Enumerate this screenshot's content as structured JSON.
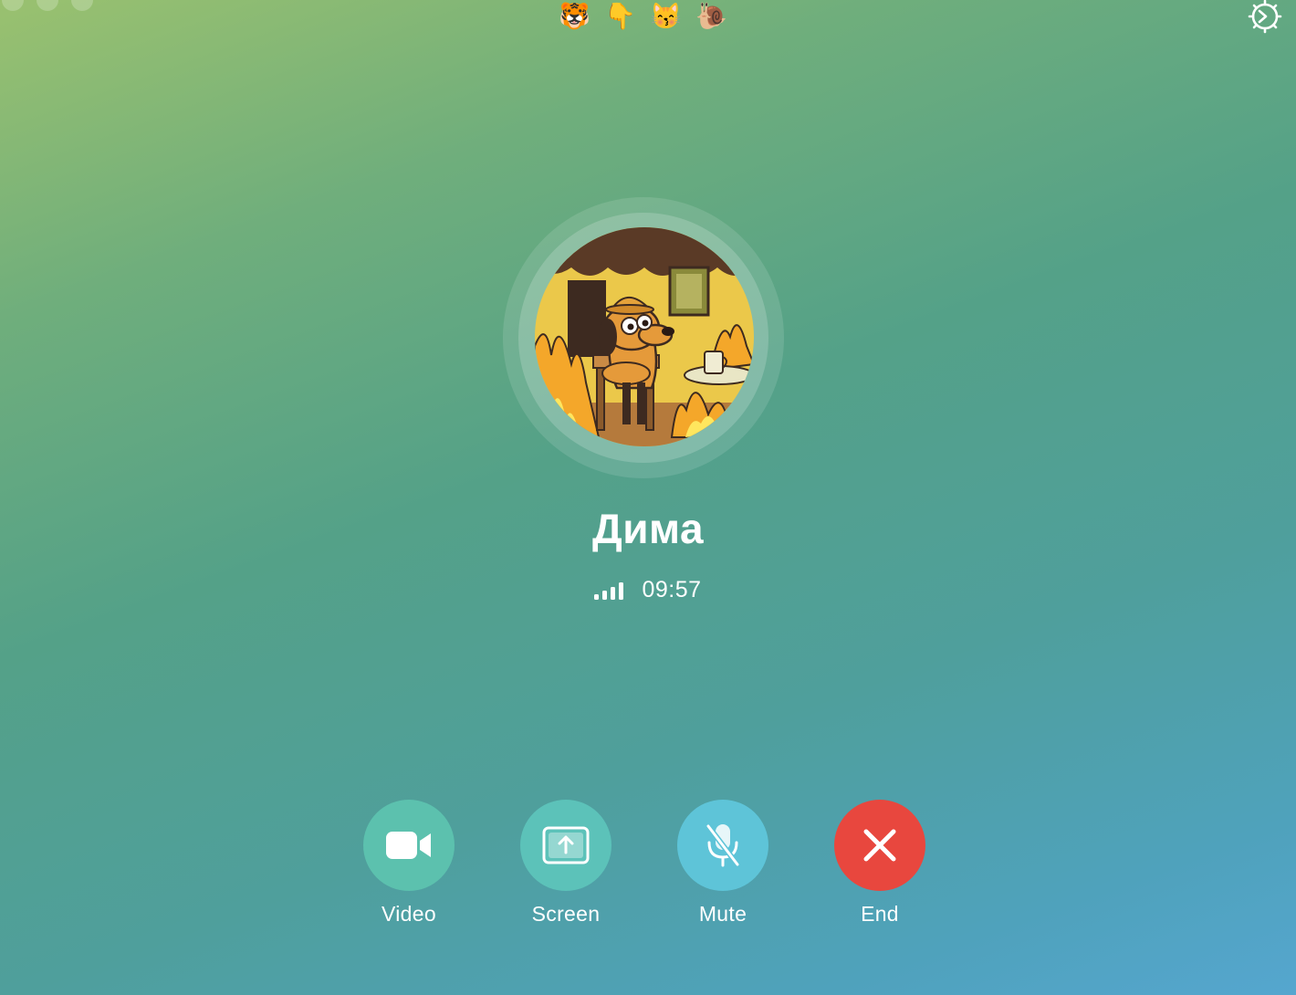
{
  "window": {
    "traffic_lights": [
      "close",
      "minimize",
      "zoom"
    ]
  },
  "emoji_key": [
    {
      "icon": "tiger-face-icon",
      "glyph": "🐯"
    },
    {
      "icon": "pointing-down-hand-icon",
      "glyph": "👇"
    },
    {
      "icon": "kissing-cat-icon",
      "glyph": "😽"
    },
    {
      "icon": "snail-icon",
      "glyph": "🐌"
    }
  ],
  "settings": {
    "icon": "gear-icon"
  },
  "contact": {
    "name": "Дима",
    "avatar_icon": "this-is-fine-dog-icon"
  },
  "call": {
    "signal_bars": 4,
    "duration": "09:57"
  },
  "controls": {
    "video": {
      "label": "Video",
      "icon": "video-camera-icon",
      "color": "#5cc1ae"
    },
    "screen": {
      "label": "Screen",
      "icon": "screen-share-icon",
      "color": "#5cc2b9"
    },
    "mute": {
      "label": "Mute",
      "icon": "microphone-off-icon",
      "color": "#5ec4d8"
    },
    "end": {
      "label": "End",
      "icon": "close-icon",
      "color": "#e8473e"
    }
  }
}
